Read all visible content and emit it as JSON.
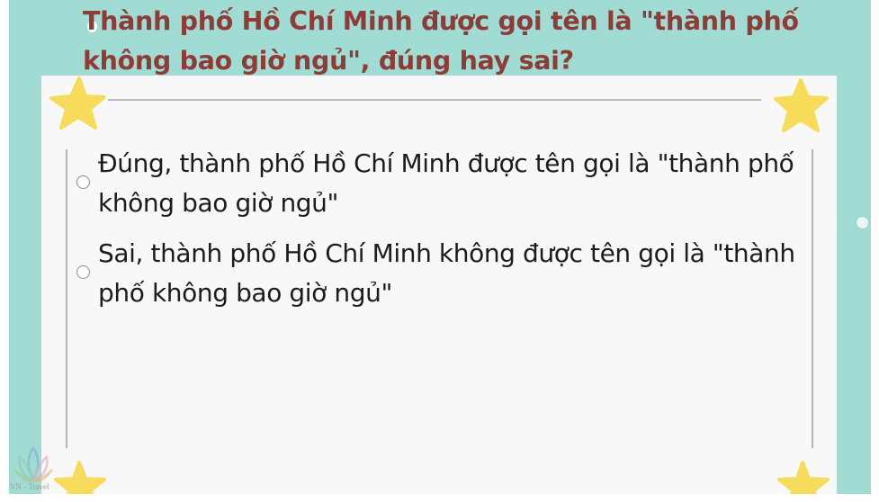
{
  "quiz": {
    "question": "Thành phố Hồ Chí Minh được gọi tên là \"thành phố không bao giờ ngủ\", đúng hay sai?",
    "options": [
      {
        "label": "Đúng, thành phố Hồ Chí Minh được tên gọi là \"thành phố không bao giờ ngủ\"",
        "selected": false
      },
      {
        "label": "Sai, thành phố Hồ Chí Minh không được tên gọi là \"thành phố không bao giờ ngủ\"",
        "selected": false
      }
    ]
  },
  "watermark": {
    "text": "VN - Travel"
  },
  "colors": {
    "slide_background": "#a0dcd3",
    "card_background": "#f8f8f8",
    "question_text": "#8f3b36",
    "option_text": "#1c1c1c",
    "star": "#f7dc5c"
  },
  "icons": {
    "decoration": "star-icon",
    "option_marker": "radio-button",
    "watermark": "lotus-logo"
  }
}
